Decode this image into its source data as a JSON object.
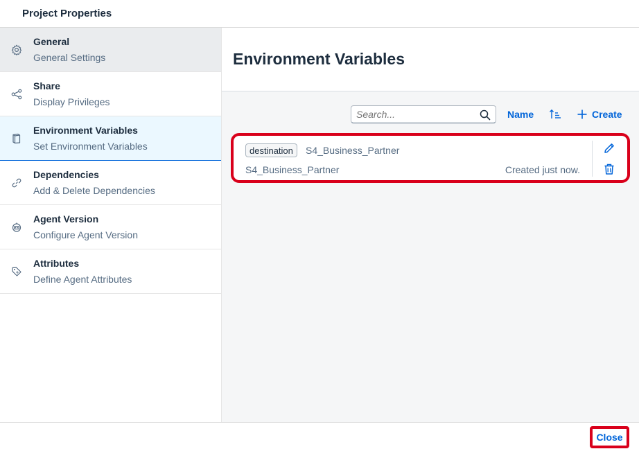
{
  "dialog": {
    "title": "Project Properties"
  },
  "sidebar": {
    "items": [
      {
        "title": "General",
        "subtitle": "General Settings",
        "icon": "gear-icon"
      },
      {
        "title": "Share",
        "subtitle": "Display Privileges",
        "icon": "share-icon"
      },
      {
        "title": "Environment Variables",
        "subtitle": "Set Environment Variables",
        "icon": "document-icon"
      },
      {
        "title": "Dependencies",
        "subtitle": "Add & Delete Dependencies",
        "icon": "link-icon"
      },
      {
        "title": "Agent Version",
        "subtitle": "Configure Agent Version",
        "icon": "robot-icon"
      },
      {
        "title": "Attributes",
        "subtitle": "Define Agent Attributes",
        "icon": "tag-icon"
      }
    ]
  },
  "main": {
    "title": "Environment Variables",
    "toolbar": {
      "search_placeholder": "Search...",
      "name_label": "Name",
      "create_label": "Create"
    },
    "variables": [
      {
        "type": "destination",
        "name": "S4_Business_Partner",
        "description": "S4_Business_Partner",
        "created": "Created just now."
      }
    ]
  },
  "footer": {
    "close_label": "Close"
  },
  "colors": {
    "accent": "#0064d9",
    "highlight": "#d9001b",
    "selected_bg": "#ebf8ff",
    "text": "#1d2d3e",
    "subtext": "#556b82"
  }
}
